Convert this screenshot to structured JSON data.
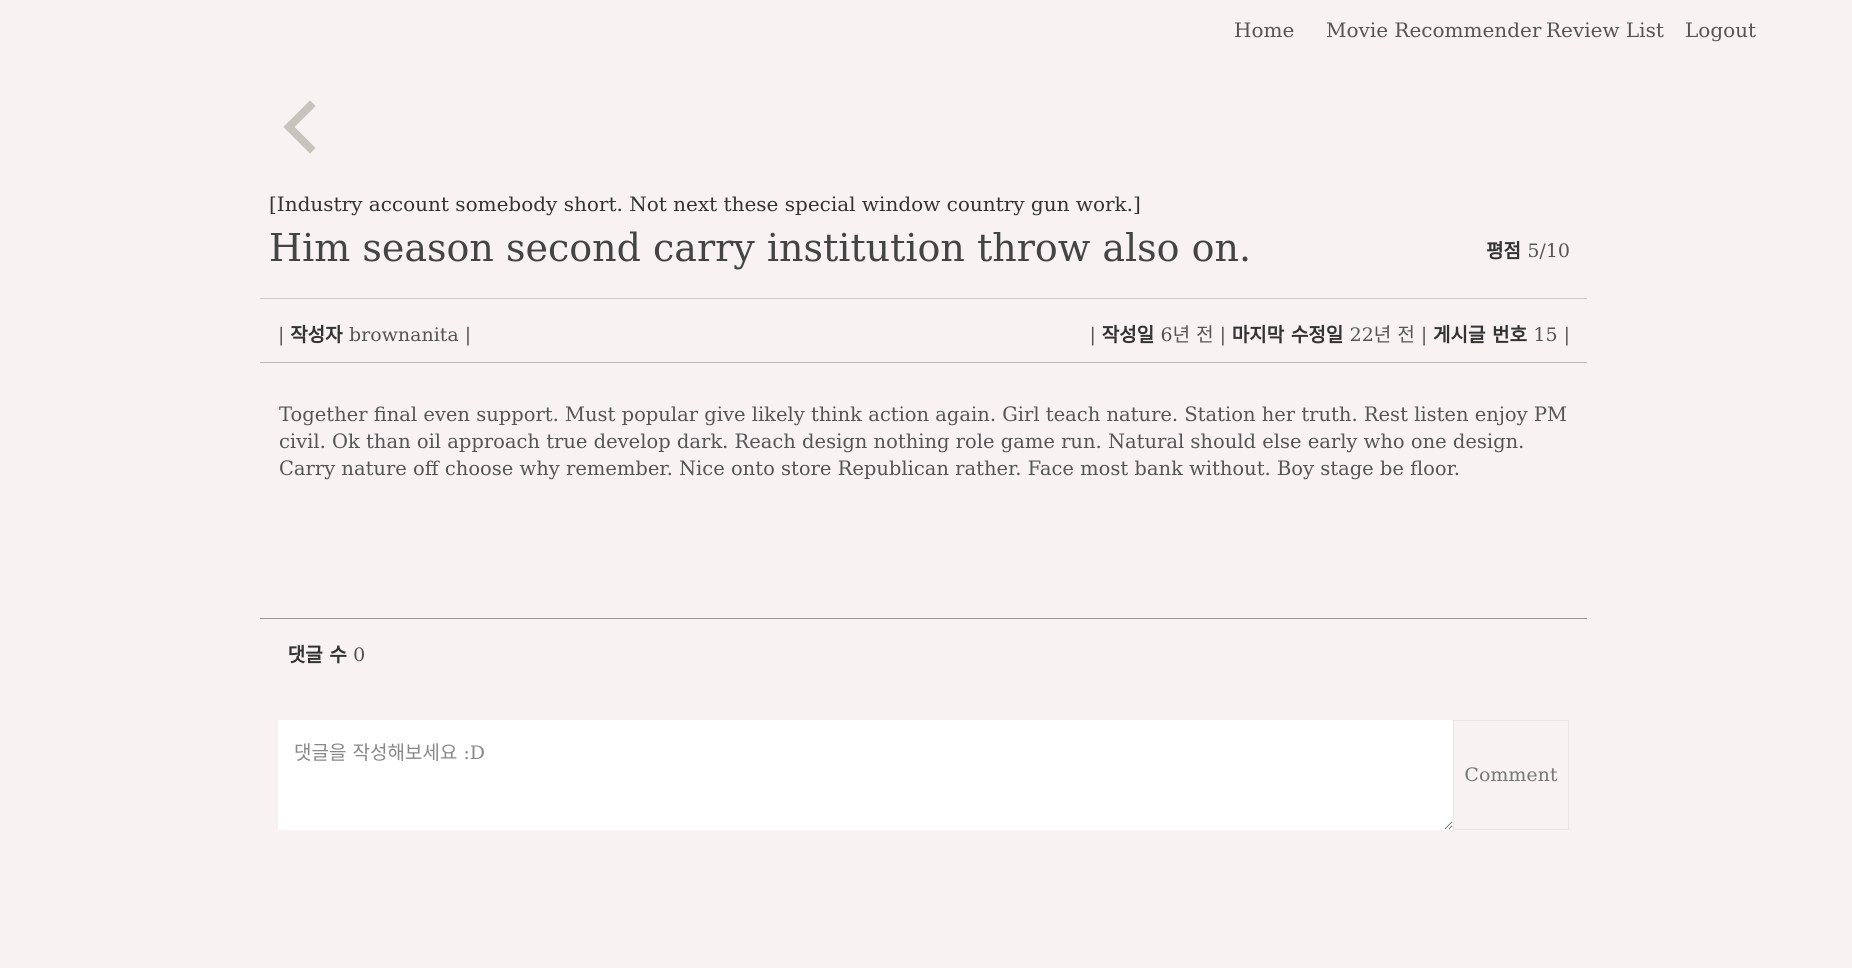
{
  "nav": {
    "home": "Home",
    "recommender": "Movie Recommender",
    "review_list": "Review List",
    "logout": "Logout"
  },
  "review": {
    "movie_title": "[Industry account somebody short. Not next these special window country gun work.]",
    "title": "Him season second carry institution throw also on.",
    "rating_label": "평점",
    "rating_value": "5/10",
    "author_label": "작성자",
    "author": "brownanita",
    "created_label": "작성일",
    "created": "6년 전",
    "modified_label": "마지막 수정일",
    "modified": "22년 전",
    "post_no_label": "게시글 번호",
    "post_no": "15",
    "content": "Together final even support. Must popular give likely think action again. Girl teach nature. Station her truth. Rest listen enjoy PM civil. Ok than oil approach true develop dark. Reach design nothing role game run. Natural should else early who one design. Carry nature off choose why remember. Nice onto store Republican rather. Face most bank without. Boy stage be floor."
  },
  "comments": {
    "count_label": "댓글 수",
    "count": "0",
    "placeholder": "댓글을 작성해보세요 :D",
    "button_label": "Comment"
  },
  "icons": {
    "back": "chevron-left-icon"
  },
  "colors": {
    "background": "#f8f3f2",
    "back_icon": "#c9c3bd"
  }
}
